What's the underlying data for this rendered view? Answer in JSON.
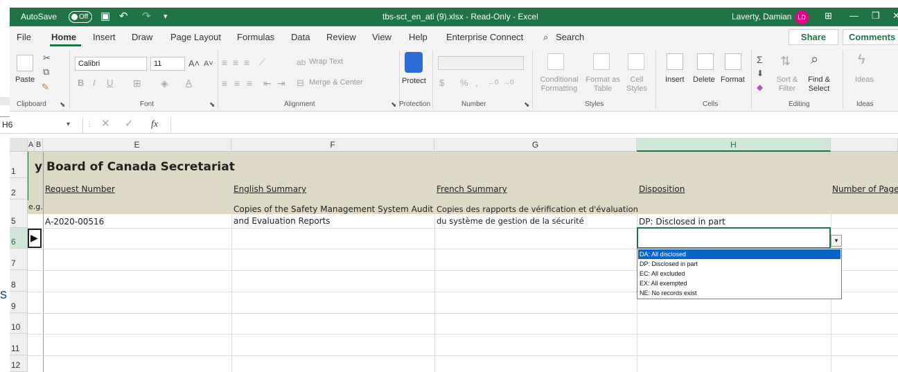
{
  "titlebar": {
    "autosave_label": "AutoSave",
    "autosave_state": "Off",
    "document_title": "tbs-sct_en_ati (9).xlsx  -  Read-Only  -  Excel",
    "user_name": "Laverty, Damian",
    "user_initials": "LD"
  },
  "menu": {
    "tabs": [
      "File",
      "Home",
      "Insert",
      "Draw",
      "Page Layout",
      "Formulas",
      "Data",
      "Review",
      "View",
      "Help",
      "Enterprise Connect"
    ],
    "search_label": "Search",
    "share_label": "Share",
    "comments_label": "Comments"
  },
  "ribbon": {
    "clipboard": {
      "paste": "Paste",
      "label": "Clipboard"
    },
    "font": {
      "name": "Calibri",
      "size": "11",
      "label": "Font"
    },
    "alignment": {
      "wrap_text": "Wrap Text",
      "merge_center": "Merge & Center",
      "label": "Alignment"
    },
    "protection": {
      "protect": "Protect",
      "label": "Protection"
    },
    "number": {
      "format": "",
      "label": "Number"
    },
    "styles": {
      "conditional": "Conditional Formatting",
      "format_table": "Format as Table",
      "cell_styles": "Cell Styles",
      "label": "Styles"
    },
    "cells": {
      "insert": "Insert",
      "delete": "Delete",
      "format": "Format",
      "label": "Cells"
    },
    "editing": {
      "sort_filter": "Sort & Filter",
      "find_select": "Find & Select",
      "label": "Editing"
    },
    "ideas": {
      "ideas": "Ideas",
      "label": "Ideas"
    }
  },
  "formula_bar": {
    "name_box": "H6",
    "fx": "fx",
    "content": ""
  },
  "grid": {
    "columns": [
      "A",
      "B",
      "E",
      "F",
      "G",
      "H"
    ],
    "rows": [
      "1",
      "2",
      "5",
      "6",
      "7",
      "8",
      "9",
      "10",
      "11",
      "12"
    ],
    "title": "y Board of Canada Secretariat",
    "headers": {
      "request": "Request Number",
      "english": "English Summary",
      "french": "French Summary",
      "disposition": "Disposition",
      "pages": "Number of Page"
    },
    "example_label": "e.g.",
    "example": {
      "request": "A-2020-00516",
      "english_line1": "Copies of the Safety Management System Audit",
      "english_line2": "and Evaluation Reports",
      "french_line1": "Copies des rapports de vérification et d'évaluation",
      "french_line2": "du système de gestion de la sécurité",
      "disposition": "DP: Disclosed in part"
    }
  },
  "dropdown": {
    "options": [
      "DA: All disclosed",
      "DP: Disclosed in part",
      "EC: All excluded",
      "EX: All exempted",
      "NE: No records exist"
    ],
    "selected_index": 0
  },
  "colors": {
    "excel_green": "#217346",
    "band": "#ddd9c4",
    "highlight": "#0a64c8"
  }
}
